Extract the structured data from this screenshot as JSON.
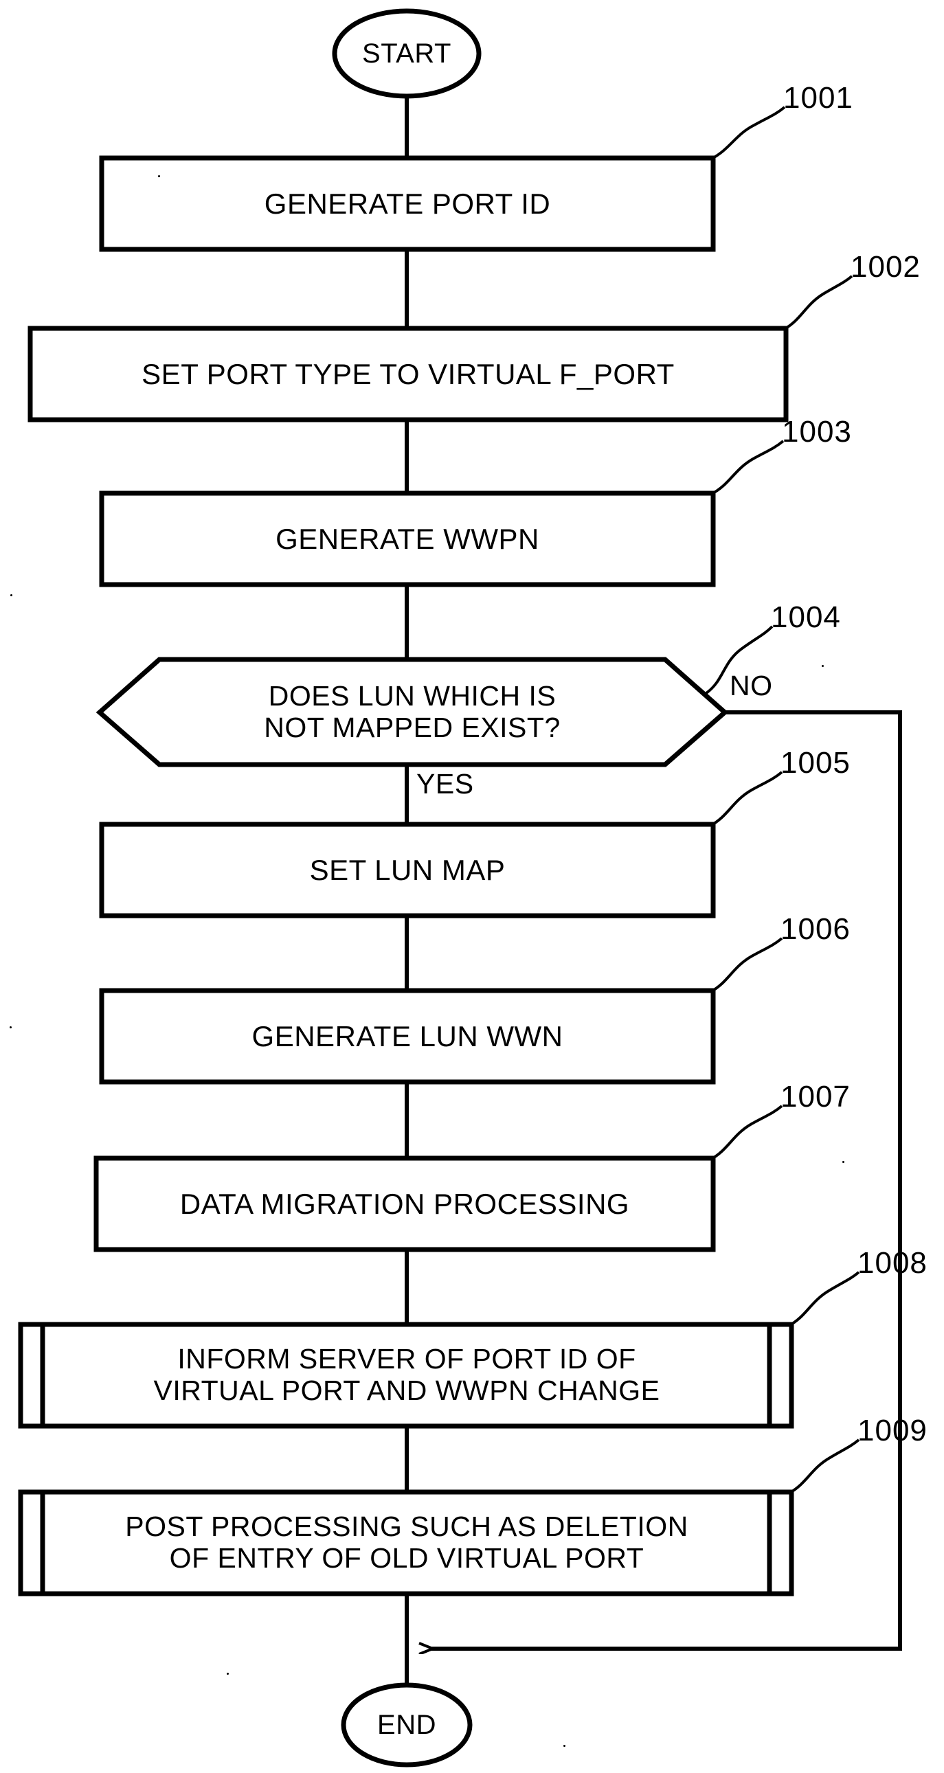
{
  "figure": {
    "type": "flowchart",
    "orientation": "vertical",
    "background_color": "#ffffff",
    "line_color": "#000000"
  },
  "terminals": {
    "start": "START",
    "end": "END"
  },
  "branches": {
    "yes": "YES",
    "no": "NO"
  },
  "steps": [
    {
      "ref": "1001",
      "shape": "process",
      "label": "GENERATE PORT ID"
    },
    {
      "ref": "1002",
      "shape": "process",
      "label": "SET PORT TYPE TO VIRTUAL F_PORT"
    },
    {
      "ref": "1003",
      "shape": "process",
      "label": "GENERATE WWPN"
    },
    {
      "ref": "1004",
      "shape": "decision",
      "label": "DOES LUN WHICH IS\nNOT MAPPED EXIST?"
    },
    {
      "ref": "1005",
      "shape": "process",
      "label": "SET LUN MAP"
    },
    {
      "ref": "1006",
      "shape": "process",
      "label": "GENERATE LUN WWN"
    },
    {
      "ref": "1007",
      "shape": "process",
      "label": "DATA MIGRATION PROCESSING"
    },
    {
      "ref": "1008",
      "shape": "predefined-process",
      "label": "INFORM SERVER OF PORT ID OF\nVIRTUAL PORT AND WWPN CHANGE"
    },
    {
      "ref": "1009",
      "shape": "predefined-process",
      "label": "POST PROCESSING SUCH AS DELETION\nOF ENTRY OF OLD VIRTUAL PORT"
    }
  ]
}
